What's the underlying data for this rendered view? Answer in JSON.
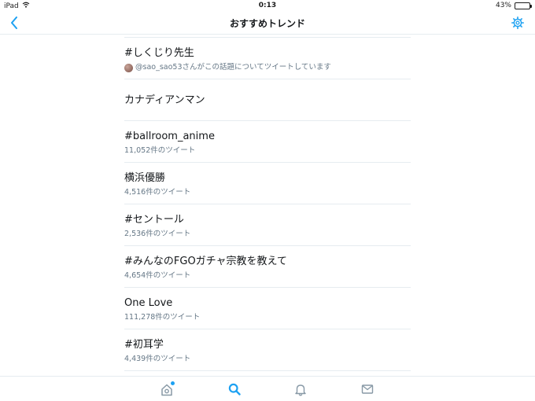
{
  "status_bar": {
    "device": "iPad",
    "time": "0:13",
    "battery": "43%",
    "battery_level": 0.43
  },
  "nav": {
    "title": "おすすめトレンド",
    "back_icon": "chevron-left-icon",
    "settings_icon": "gear-icon"
  },
  "trends": [
    {
      "name": "#しくじり先生",
      "meta": "@sao_sao53さんがこの話題についてツイートしています",
      "has_avatar": true
    },
    {
      "name": "カナディアンマン",
      "meta": ""
    },
    {
      "name": "#ballroom_anime",
      "meta": "11,052件のツイート"
    },
    {
      "name": "横浜優勝",
      "meta": "4,516件のツイート"
    },
    {
      "name": "#セントール",
      "meta": "2,536件のツイート"
    },
    {
      "name": "#みんなのFGOガチャ宗教を教えて",
      "meta": "4,654件のツイート"
    },
    {
      "name": "One Love",
      "meta": "111,278件のツイート"
    },
    {
      "name": "#初耳学",
      "meta": "4,439件のツイート"
    }
  ],
  "tabbar": {
    "items": [
      "home-icon",
      "search-icon",
      "notifications-icon",
      "messages-icon"
    ],
    "active": "search-icon"
  },
  "colors": {
    "accent": "#1da1f2",
    "meta_text": "#657786",
    "icon_gray": "#8899a6",
    "divider": "#e6ecf0"
  }
}
